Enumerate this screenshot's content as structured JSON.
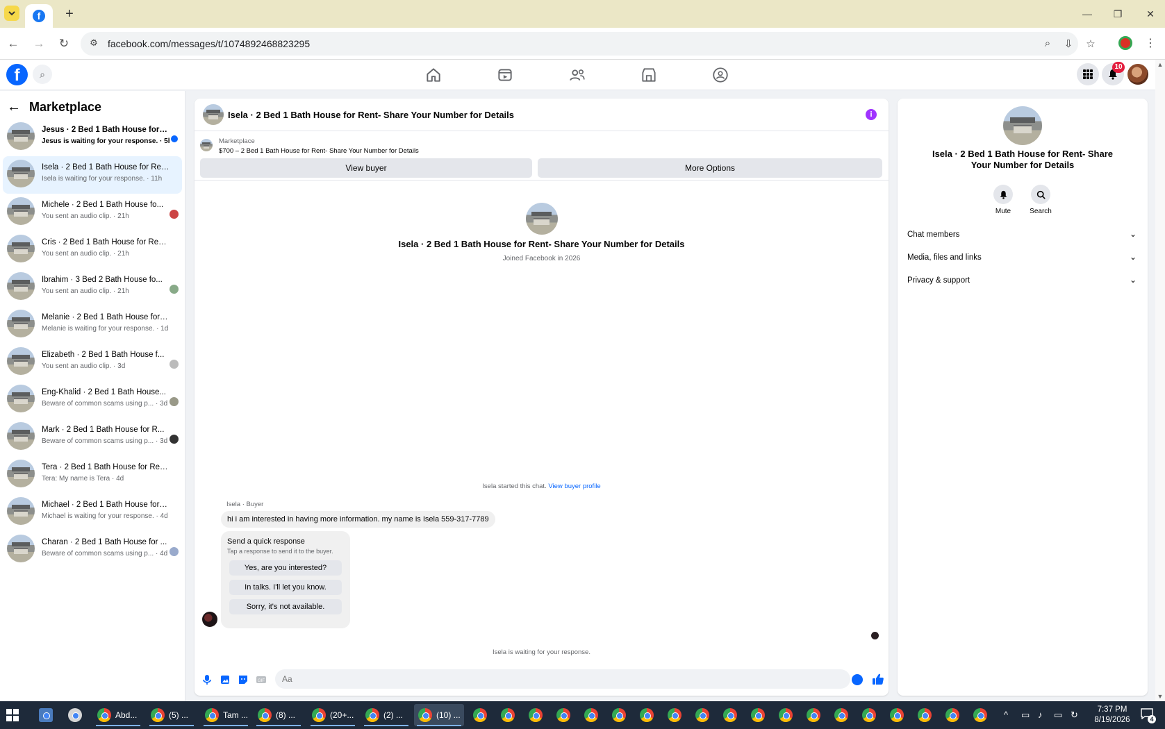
{
  "browser": {
    "url": "facebook.com/messages/t/1074892468823295",
    "new_tab": "+",
    "minimize": "—",
    "restore": "❐",
    "close": "✕"
  },
  "fb": {
    "notification_count": "10"
  },
  "sidebar": {
    "title": "Marketplace",
    "conversations": [
      {
        "name": "Jesus · 2 Bed 1 Bath House for Re...",
        "sub": "Jesus is waiting for your response. · 5h",
        "unread": true
      },
      {
        "name": "Isela · 2 Bed 1 Bath House for Rent...",
        "sub": "Isela is waiting for your response. · 11h",
        "active": true
      },
      {
        "name": "Michele · 2 Bed 1 Bath House fo...",
        "sub": "You sent an audio clip. · 21h"
      },
      {
        "name": "Cris · 2 Bed 1 Bath House for Rent-...",
        "sub": "You sent an audio clip. · 21h"
      },
      {
        "name": "Ibrahim · 3 Bed 2 Bath House fo...",
        "sub": "You sent an audio clip. · 21h"
      },
      {
        "name": "Melanie · 2 Bed 1 Bath House for R...",
        "sub": "Melanie is waiting for your response. · 1d"
      },
      {
        "name": "Elizabeth · 2 Bed 1 Bath House f...",
        "sub": "You sent an audio clip. · 3d"
      },
      {
        "name": "Eng-Khalid · 2 Bed 1 Bath House...",
        "sub": "Beware of common scams using p... · 3d"
      },
      {
        "name": "Mark · 2 Bed 1 Bath House for R...",
        "sub": "Beware of common scams using p... · 3d"
      },
      {
        "name": "Tera · 2 Bed 1 Bath House for Rent-...",
        "sub": "Tera: My name is Tera · 4d"
      },
      {
        "name": "Michael · 2 Bed 1 Bath House for R...",
        "sub": "Michael is waiting for your response. · 4d"
      },
      {
        "name": "Charan · 2 Bed 1 Bath House for ...",
        "sub": "Beware of common scams using p... · 4d"
      }
    ]
  },
  "chat": {
    "title": "Isela · 2 Bed 1 Bath House for Rent- Share Your Number for Details",
    "marketplace_label": "Marketplace",
    "listing": "$700 – 2 Bed 1 Bath House for Rent- Share Your Number for Details",
    "view_buyer_button": "View buyer",
    "more_options_button": "More Options",
    "profile_name": "Isela · 2 Bed 1 Bath House for Rent- Share Your Number for Details",
    "joined": "Joined Facebook in 2026",
    "started_text": "Isela started this chat.",
    "view_buyer_profile_link": "View buyer profile",
    "sender_label": "Isela · Buyer",
    "message": "hi i am interested in having more information. my name is Isela 559-317-7789",
    "quick_response_title": "Send a quick response",
    "quick_response_sub": "Tap a response to send it to the buyer.",
    "quick_responses": [
      "Yes, are you interested?",
      "In talks. I'll let you know.",
      "Sorry, it's not available."
    ],
    "waiting_text": "Isela is waiting for your response.",
    "composer_placeholder": "Aa"
  },
  "info_panel": {
    "name": "Isela · 2 Bed 1 Bath House for Rent- Share Your Number for Details",
    "mute_label": "Mute",
    "search_label": "Search",
    "sections": [
      "Chat members",
      "Media, files and links",
      "Privacy & support"
    ]
  },
  "taskbar": {
    "items": [
      "Abd...",
      "(5) ...",
      "Tam ...",
      "(8) ...",
      "(20+...",
      "(2) ...",
      "(10) ..."
    ],
    "time": "7:37 PM",
    "date": "8/19/2026",
    "notification_count": "4"
  }
}
